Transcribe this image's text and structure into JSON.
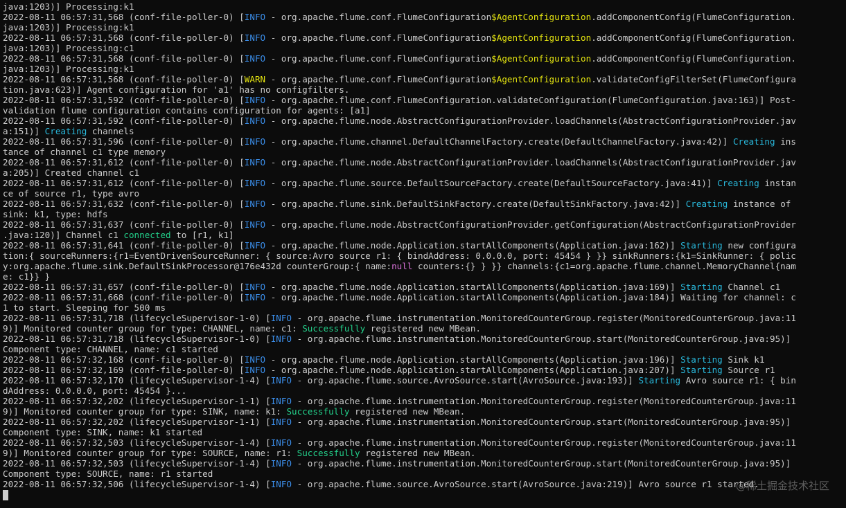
{
  "colors": {
    "background": "#0c0c0c",
    "text": "#cccccc",
    "info": "#3b8eea",
    "warn": "#e5e510",
    "green": "#23d18b",
    "cyan": "#29b8db",
    "magenta": "#d670d6"
  },
  "lines": [
    [
      [
        "t",
        "java:1203)] Processing:k1"
      ]
    ],
    [
      [
        "t",
        "2022-08-11 06:57:31,568 (conf-file-poller-0) ["
      ],
      [
        "i",
        "INFO"
      ],
      [
        "t",
        " - org.apache.flume.conf.FlumeConfiguration"
      ],
      [
        "a",
        "$AgentConfiguration"
      ],
      [
        "t",
        ".addComponentConfig(FlumeConfiguration."
      ]
    ],
    [
      [
        "t",
        "java:1203)] Processing:k1"
      ]
    ],
    [
      [
        "t",
        "2022-08-11 06:57:31,568 (conf-file-poller-0) ["
      ],
      [
        "i",
        "INFO"
      ],
      [
        "t",
        " - org.apache.flume.conf.FlumeConfiguration"
      ],
      [
        "a",
        "$AgentConfiguration"
      ],
      [
        "t",
        ".addComponentConfig(FlumeConfiguration."
      ]
    ],
    [
      [
        "t",
        "java:1203)] Processing:c1"
      ]
    ],
    [
      [
        "t",
        "2022-08-11 06:57:31,568 (conf-file-poller-0) ["
      ],
      [
        "i",
        "INFO"
      ],
      [
        "t",
        " - org.apache.flume.conf.FlumeConfiguration"
      ],
      [
        "a",
        "$AgentConfiguration"
      ],
      [
        "t",
        ".addComponentConfig(FlumeConfiguration."
      ]
    ],
    [
      [
        "t",
        "java:1203)] Processing:k1"
      ]
    ],
    [
      [
        "t",
        "2022-08-11 06:57:31,568 (conf-file-poller-0) ["
      ],
      [
        "w",
        "WARN"
      ],
      [
        "t",
        " - org.apache.flume.conf.FlumeConfiguration"
      ],
      [
        "a",
        "$AgentConfiguration"
      ],
      [
        "t",
        ".validateConfigFilterSet(FlumeConfigura"
      ]
    ],
    [
      [
        "t",
        "tion.java:623)] Agent configuration for 'a1' has no configfilters."
      ]
    ],
    [
      [
        "t",
        "2022-08-11 06:57:31,592 (conf-file-poller-0) ["
      ],
      [
        "i",
        "INFO"
      ],
      [
        "t",
        " - org.apache.flume.conf.FlumeConfiguration.validateConfiguration(FlumeConfiguration.java:163)] Post-"
      ]
    ],
    [
      [
        "t",
        "validation flume configuration contains configuration for agents: [a1]"
      ]
    ],
    [
      [
        "t",
        "2022-08-11 06:57:31,592 (conf-file-poller-0) ["
      ],
      [
        "i",
        "INFO"
      ],
      [
        "t",
        " - org.apache.flume.node.AbstractConfigurationProvider.loadChannels(AbstractConfigurationProvider.jav"
      ]
    ],
    [
      [
        "t",
        "a:151)] "
      ],
      [
        "c",
        "Creating"
      ],
      [
        "t",
        " channels"
      ]
    ],
    [
      [
        "t",
        "2022-08-11 06:57:31,596 (conf-file-poller-0) ["
      ],
      [
        "i",
        "INFO"
      ],
      [
        "t",
        " - org.apache.flume.channel.DefaultChannelFactory.create(DefaultChannelFactory.java:42)] "
      ],
      [
        "c",
        "Creating"
      ],
      [
        "t",
        " ins"
      ]
    ],
    [
      [
        "t",
        "tance of channel c1 type memory"
      ]
    ],
    [
      [
        "t",
        "2022-08-11 06:57:31,612 (conf-file-poller-0) ["
      ],
      [
        "i",
        "INFO"
      ],
      [
        "t",
        " - org.apache.flume.node.AbstractConfigurationProvider.loadChannels(AbstractConfigurationProvider.jav"
      ]
    ],
    [
      [
        "t",
        "a:205)] Created channel c1"
      ]
    ],
    [
      [
        "t",
        "2022-08-11 06:57:31,612 (conf-file-poller-0) ["
      ],
      [
        "i",
        "INFO"
      ],
      [
        "t",
        " - org.apache.flume.source.DefaultSourceFactory.create(DefaultSourceFactory.java:41)] "
      ],
      [
        "c",
        "Creating"
      ],
      [
        "t",
        " instan"
      ]
    ],
    [
      [
        "t",
        "ce of source r1, type avro"
      ]
    ],
    [
      [
        "t",
        "2022-08-11 06:57:31,632 (conf-file-poller-0) ["
      ],
      [
        "i",
        "INFO"
      ],
      [
        "t",
        " - org.apache.flume.sink.DefaultSinkFactory.create(DefaultSinkFactory.java:42)] "
      ],
      [
        "c",
        "Creating"
      ],
      [
        "t",
        " instance of"
      ]
    ],
    [
      [
        "t",
        "sink: k1, type: hdfs"
      ]
    ],
    [
      [
        "t",
        "2022-08-11 06:57:31,637 (conf-file-poller-0) ["
      ],
      [
        "i",
        "INFO"
      ],
      [
        "t",
        " - org.apache.flume.node.AbstractConfigurationProvider.getConfiguration(AbstractConfigurationProvider"
      ]
    ],
    [
      [
        "t",
        ".java:120)] Channel c1 "
      ],
      [
        "g",
        "connected"
      ],
      [
        "t",
        " to [r1, k1]"
      ]
    ],
    [
      [
        "t",
        "2022-08-11 06:57:31,641 (conf-file-poller-0) ["
      ],
      [
        "i",
        "INFO"
      ],
      [
        "t",
        " - org.apache.flume.node.Application.startAllComponents(Application.java:162)] "
      ],
      [
        "c",
        "Starting"
      ],
      [
        "t",
        " new configura"
      ]
    ],
    [
      [
        "t",
        "tion:{ sourceRunners:{r1=EventDrivenSourceRunner: { source:Avro source r1: { bindAddress: 0.0.0.0, port: 45454 } }} sinkRunners:{k1=SinkRunner: { polic"
      ]
    ],
    [
      [
        "t",
        "y:org.apache.flume.sink.DefaultSinkProcessor@176e432d counterGroup:{ name:"
      ],
      [
        "m",
        "null"
      ],
      [
        "t",
        " counters:{} } }} channels:{c1=org.apache.flume.channel.MemoryChannel{nam"
      ]
    ],
    [
      [
        "t",
        "e: c1}} }"
      ]
    ],
    [
      [
        "t",
        "2022-08-11 06:57:31,657 (conf-file-poller-0) ["
      ],
      [
        "i",
        "INFO"
      ],
      [
        "t",
        " - org.apache.flume.node.Application.startAllComponents(Application.java:169)] "
      ],
      [
        "c",
        "Starting"
      ],
      [
        "t",
        " Channel c1"
      ]
    ],
    [
      [
        "t",
        "2022-08-11 06:57:31,668 (conf-file-poller-0) ["
      ],
      [
        "i",
        "INFO"
      ],
      [
        "t",
        " - org.apache.flume.node.Application.startAllComponents(Application.java:184)] Waiting for channel: c"
      ]
    ],
    [
      [
        "t",
        "1 to start. Sleeping for 500 ms"
      ]
    ],
    [
      [
        "t",
        "2022-08-11 06:57:31,718 (lifecycleSupervisor-1-0) ["
      ],
      [
        "i",
        "INFO"
      ],
      [
        "t",
        " - org.apache.flume.instrumentation.MonitoredCounterGroup.register(MonitoredCounterGroup.java:11"
      ]
    ],
    [
      [
        "t",
        "9)] Monitored counter group for type: CHANNEL, name: c1: "
      ],
      [
        "g",
        "Successfully"
      ],
      [
        "t",
        " registered new MBean."
      ]
    ],
    [
      [
        "t",
        "2022-08-11 06:57:31,718 (lifecycleSupervisor-1-0) ["
      ],
      [
        "i",
        "INFO"
      ],
      [
        "t",
        " - org.apache.flume.instrumentation.MonitoredCounterGroup.start(MonitoredCounterGroup.java:95)]"
      ]
    ],
    [
      [
        "t",
        "Component type: CHANNEL, name: c1 started"
      ]
    ],
    [
      [
        "t",
        "2022-08-11 06:57:32,168 (conf-file-poller-0) ["
      ],
      [
        "i",
        "INFO"
      ],
      [
        "t",
        " - org.apache.flume.node.Application.startAllComponents(Application.java:196)] "
      ],
      [
        "c",
        "Starting"
      ],
      [
        "t",
        " Sink k1"
      ]
    ],
    [
      [
        "t",
        "2022-08-11 06:57:32,169 (conf-file-poller-0) ["
      ],
      [
        "i",
        "INFO"
      ],
      [
        "t",
        " - org.apache.flume.node.Application.startAllComponents(Application.java:207)] "
      ],
      [
        "c",
        "Starting"
      ],
      [
        "t",
        " Source r1"
      ]
    ],
    [
      [
        "t",
        "2022-08-11 06:57:32,170 (lifecycleSupervisor-1-4) ["
      ],
      [
        "i",
        "INFO"
      ],
      [
        "t",
        " - org.apache.flume.source.AvroSource.start(AvroSource.java:193)] "
      ],
      [
        "c",
        "Starting"
      ],
      [
        "t",
        " Avro source r1: { bin"
      ]
    ],
    [
      [
        "t",
        "dAddress: 0.0.0.0, port: 45454 }..."
      ]
    ],
    [
      [
        "t",
        "2022-08-11 06:57:32,202 (lifecycleSupervisor-1-1) ["
      ],
      [
        "i",
        "INFO"
      ],
      [
        "t",
        " - org.apache.flume.instrumentation.MonitoredCounterGroup.register(MonitoredCounterGroup.java:11"
      ]
    ],
    [
      [
        "t",
        "9)] Monitored counter group for type: SINK, name: k1: "
      ],
      [
        "g",
        "Successfully"
      ],
      [
        "t",
        " registered new MBean."
      ]
    ],
    [
      [
        "t",
        "2022-08-11 06:57:32,202 (lifecycleSupervisor-1-1) ["
      ],
      [
        "i",
        "INFO"
      ],
      [
        "t",
        " - org.apache.flume.instrumentation.MonitoredCounterGroup.start(MonitoredCounterGroup.java:95)]"
      ]
    ],
    [
      [
        "t",
        "Component type: SINK, name: k1 started"
      ]
    ],
    [
      [
        "t",
        "2022-08-11 06:57:32,503 (lifecycleSupervisor-1-4) ["
      ],
      [
        "i",
        "INFO"
      ],
      [
        "t",
        " - org.apache.flume.instrumentation.MonitoredCounterGroup.register(MonitoredCounterGroup.java:11"
      ]
    ],
    [
      [
        "t",
        "9)] Monitored counter group for type: SOURCE, name: r1: "
      ],
      [
        "g",
        "Successfully"
      ],
      [
        "t",
        " registered new MBean."
      ]
    ],
    [
      [
        "t",
        "2022-08-11 06:57:32,503 (lifecycleSupervisor-1-4) ["
      ],
      [
        "i",
        "INFO"
      ],
      [
        "t",
        " - org.apache.flume.instrumentation.MonitoredCounterGroup.start(MonitoredCounterGroup.java:95)]"
      ]
    ],
    [
      [
        "t",
        "Component type: SOURCE, name: r1 started"
      ]
    ],
    [
      [
        "t",
        "2022-08-11 06:57:32,506 (lifecycleSupervisor-1-4) ["
      ],
      [
        "i",
        "INFO"
      ],
      [
        "t",
        " - org.apache.flume.source.AvroSource.start(AvroSource.java:219)] Avro source r1 started."
      ]
    ]
  ],
  "watermark": "@稀土掘金技术社区"
}
